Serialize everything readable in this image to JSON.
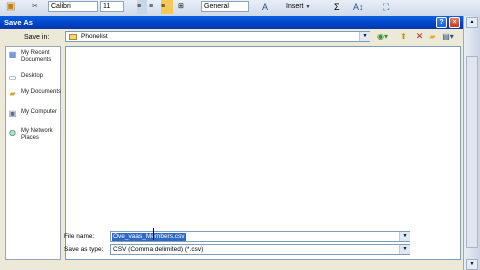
{
  "ribbon": {
    "font_name": "Calibri",
    "font_size": "11",
    "number_format": "General",
    "insert_label": "Insert",
    "sum_symbol": "Σ"
  },
  "dialog": {
    "title": "Save As",
    "help_label": "?",
    "close_label": "×",
    "save_in_label": "Save in:",
    "save_in_value": "Phonelist",
    "places": [
      {
        "label": "My Recent Documents",
        "icon": "recent-documents-icon"
      },
      {
        "label": "Desktop",
        "icon": "desktop-icon"
      },
      {
        "label": "My Documents",
        "icon": "my-documents-icon"
      },
      {
        "label": "My Computer",
        "icon": "my-computer-icon"
      },
      {
        "label": "My Network Places",
        "icon": "network-places-icon"
      }
    ],
    "file_name_label": "File name:",
    "file_name_value": "Ove_vaas_Members.csv",
    "save_as_type_label": "Save as type:",
    "save_as_type_value": "CSV (Comma delimited) (*.csv)"
  },
  "colors": {
    "titlebar": "#0044c8",
    "dialog_bg": "#ece9d8",
    "selection": "#316ac5"
  }
}
